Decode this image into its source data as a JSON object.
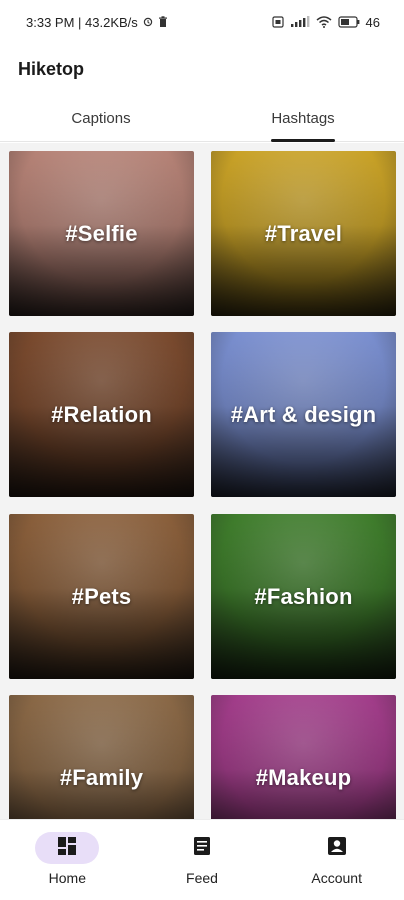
{
  "status_bar": {
    "time_speed": "3:33 PM | 43.2KB/s",
    "battery": "46"
  },
  "app": {
    "title": "Hiketop"
  },
  "tabs": [
    {
      "label": "Captions",
      "active": false
    },
    {
      "label": "Hashtags",
      "active": true
    }
  ],
  "cards": [
    {
      "label": "#Selfie",
      "color": "#b58276"
    },
    {
      "label": "#Travel",
      "color": "#c9a227"
    },
    {
      "label": "#Relation",
      "color": "#7a4a2e"
    },
    {
      "label": "#Art & design",
      "color": "#7a8fd0"
    },
    {
      "label": "#Pets",
      "color": "#8a5f3b"
    },
    {
      "label": "#Fashion",
      "color": "#3f7d2c"
    },
    {
      "label": "#Family",
      "color": "#8a6846"
    },
    {
      "label": "#Makeup",
      "color": "#a23d8a"
    }
  ],
  "nav": [
    {
      "label": "Home",
      "icon": "dashboard-icon",
      "active": true
    },
    {
      "label": "Feed",
      "icon": "article-icon",
      "active": false
    },
    {
      "label": "Account",
      "icon": "account-box-icon",
      "active": false
    }
  ]
}
